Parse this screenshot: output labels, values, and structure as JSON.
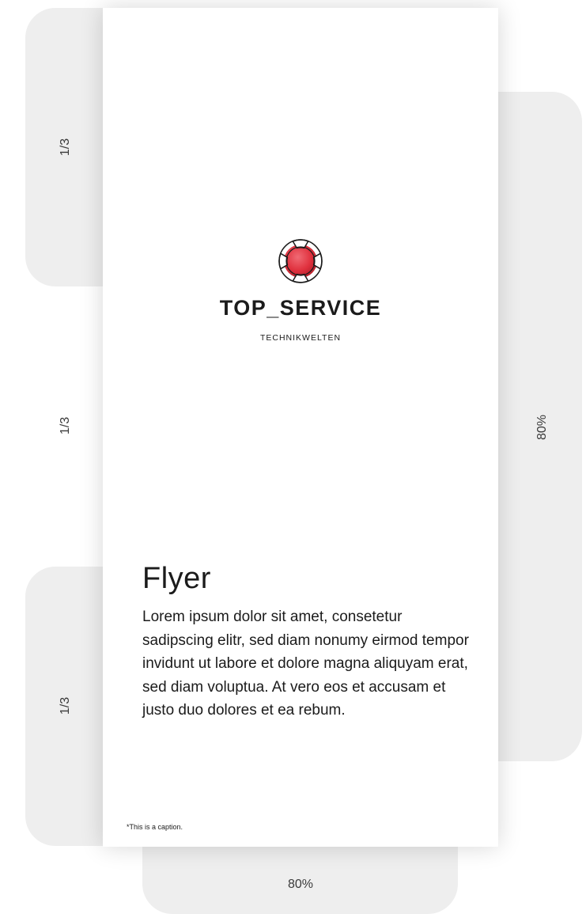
{
  "guides": {
    "third_top": "1/3",
    "third_middle": "1/3",
    "third_bottom": "1/3",
    "height_percent": "80%",
    "width_percent": "80%"
  },
  "flyer": {
    "brand": "TOP_SERVICE",
    "tagline": "TECHNIKWELTEN",
    "logo_icon": "lifebuoy-icon",
    "heading": "Flyer",
    "body": "Lorem ipsum dolor sit amet, consetetur sadipscing elitr, sed diam nonumy eirmod tempor invidunt ut labore et dolore magna aliquyam erat, sed diam voluptua. At vero eos et accusam et justo duo dolores et ea rebum.",
    "caption": "*This is a caption."
  },
  "colors": {
    "accent": "#e0313e",
    "guide": "#eeeeee",
    "text": "#1b1b1b"
  }
}
